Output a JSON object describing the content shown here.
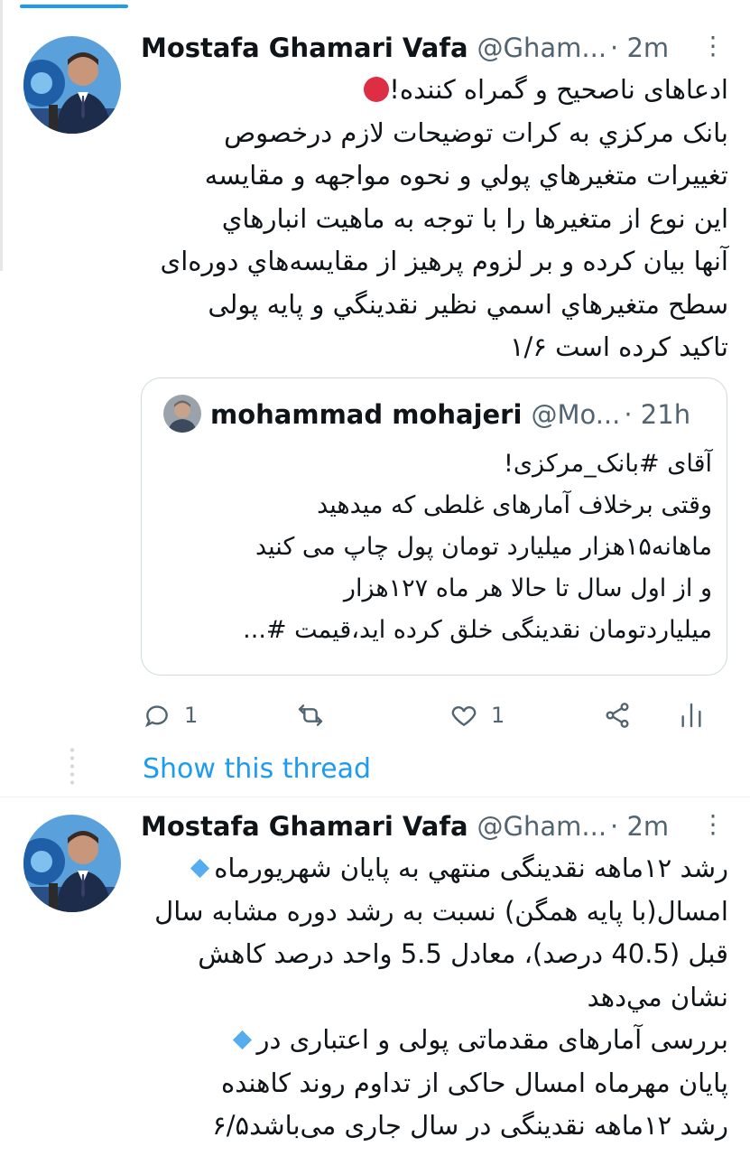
{
  "tweet1": {
    "author_name": "Mostafa Ghamari Vafa",
    "handle": "@Gham...",
    "time": "· 2m",
    "more_icon": "more-dots-icon",
    "lines": [
      "ادعاهای ناصحیح و گمراه کننده!",
      "بانک مرکزي به کرات توضيحات لازم درخصوص",
      "تغييرات متغيرهاي پولي و نحوه مواجهه و مقايسه",
      "اين نوع از متغيرها را با توجه به ماهيت انبارهاي",
      "آنها بيان کرده و بر لزوم پرهيز از مقايسه‌هاي دوره‌ای",
      "سطح متغيرهاي اسمي نظير نقدينگي و پايه پولی",
      "تاکيد کرده است ۱/۶"
    ]
  },
  "quote": {
    "author_name": "mohammad mohajeri",
    "handle": "@Mo...",
    "time": "· 21h",
    "lines": [
      "آقای #بانک_مرکزی!",
      "وقتی برخلاف آمارهای غلطی که میدهید",
      "ماهانه۱۵هزار میلیارد تومان پول چاپ می کنید",
      "و از اول سال تا حالا هر ماه ۱۲۷هزار",
      "میلیاردتومان نقدینگی خلق کرده اید،قیمت #..."
    ]
  },
  "actions": {
    "reply_count": "1",
    "retweet_count": "",
    "like_count": "1",
    "reply_icon": "reply-icon",
    "retweet_icon": "retweet-icon",
    "like_icon": "heart-icon",
    "share_icon": "share-icon",
    "analytics_icon": "analytics-icon"
  },
  "show_thread": "Show this thread",
  "tweet2": {
    "author_name": "Mostafa Ghamari Vafa",
    "handle": "@Gham...",
    "time": "· 2m",
    "lines": [
      "رشد ۱۲ماهه نقدينگی منتهي به پايان شهريورماه",
      "امسال(با پايه همگن) نسبت به رشد دوره مشابه سال",
      "قبل (40.5 درصد)، معادل 5.5 واحد درصد کاهش",
      "نشان مي‌دهد",
      "بررسی آمارهای مقدماتی پولی و اعتباری در",
      "پایان مهرماه امسال حاکی از تداوم روند کاهنده",
      "رشد ۱۲ماهه نقدینگی در سال جاری می‌باشد۶/۵"
    ]
  },
  "colors": {
    "accent": "#1d9bf0",
    "text": "#0f1419",
    "secondary": "#536471",
    "red_dot": "#dd2e44",
    "diamond": "#55acee"
  }
}
